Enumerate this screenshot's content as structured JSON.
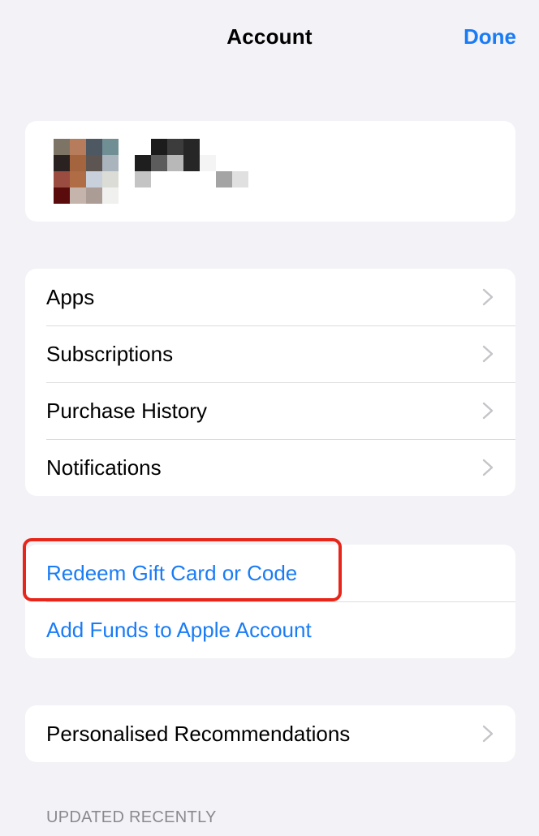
{
  "header": {
    "title": "Account",
    "done_label": "Done"
  },
  "menu": {
    "items": [
      {
        "label": "Apps"
      },
      {
        "label": "Subscriptions"
      },
      {
        "label": "Purchase History"
      },
      {
        "label": "Notifications"
      }
    ]
  },
  "actions": {
    "redeem_label": "Redeem Gift Card or Code",
    "add_funds_label": "Add Funds to Apple Account"
  },
  "recommendations": {
    "label": "Personalised Recommendations"
  },
  "updated_section": {
    "header": "UPDATED RECENTLY"
  },
  "colors": {
    "accent": "#1a7cf5",
    "highlight": "#e8251a",
    "background": "#f2f2f7"
  },
  "icons": {
    "row_chevron": "chevron-right-icon"
  }
}
